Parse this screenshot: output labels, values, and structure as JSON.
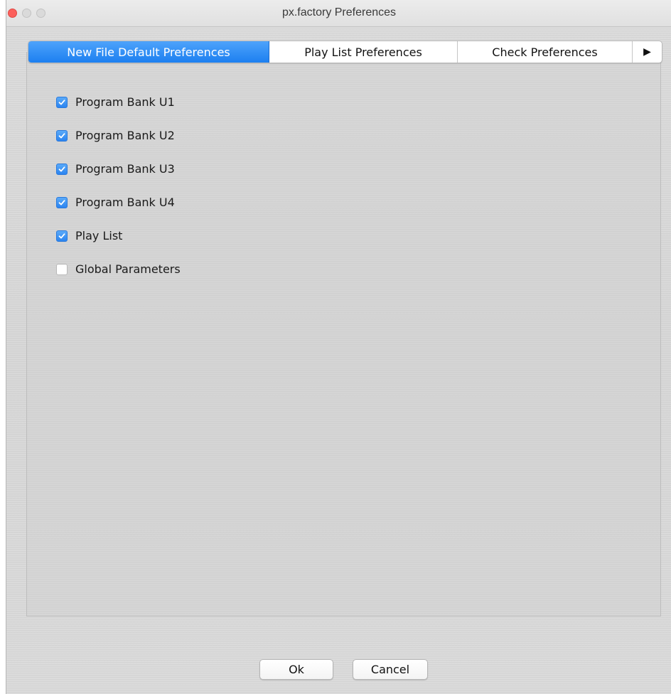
{
  "window": {
    "title": "px.factory Preferences"
  },
  "tabs": [
    {
      "label": "New File Default Preferences",
      "active": true
    },
    {
      "label": "Play List Preferences",
      "active": false
    },
    {
      "label": "Check Preferences",
      "active": false
    }
  ],
  "tab_scroll": {
    "label": "▶"
  },
  "options": [
    {
      "label": "Program Bank U1",
      "checked": true
    },
    {
      "label": "Program Bank U2",
      "checked": true
    },
    {
      "label": "Program Bank U3",
      "checked": true
    },
    {
      "label": "Program Bank U4",
      "checked": true
    },
    {
      "label": "Play List",
      "checked": true
    },
    {
      "label": "Global Parameters",
      "checked": false
    }
  ],
  "buttons": {
    "ok_label": "Ok",
    "cancel_label": "Cancel"
  },
  "colors": {
    "accent": "#1c7ff0",
    "close_button": "#fc605c"
  }
}
